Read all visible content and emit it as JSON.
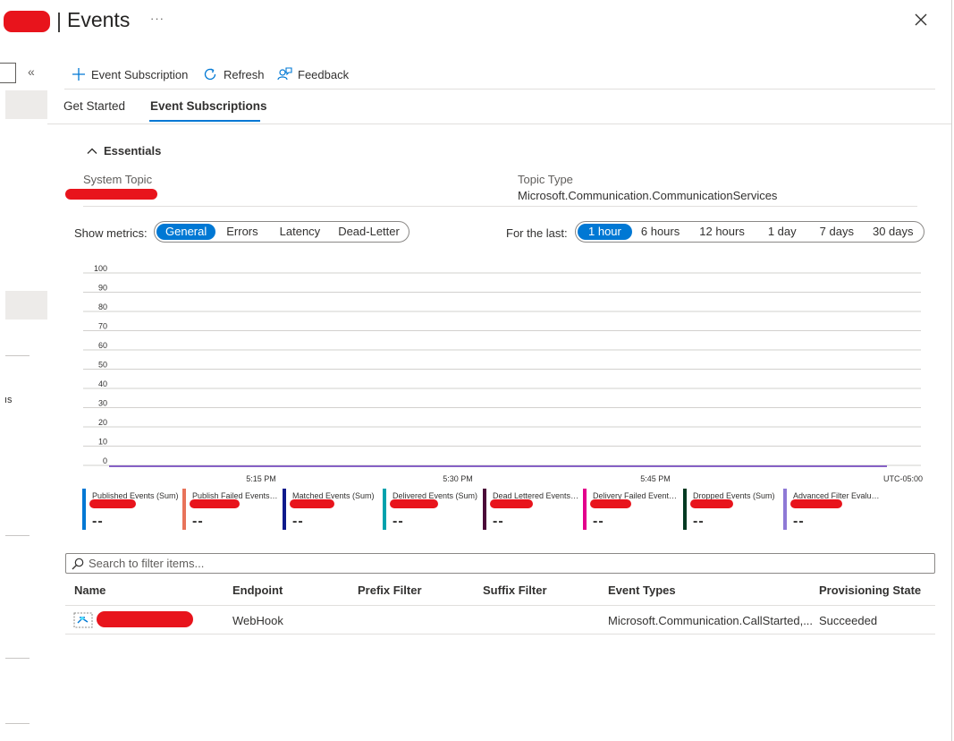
{
  "header": {
    "title": "Events",
    "separator": "|",
    "more": "···"
  },
  "left_rail": {
    "partial_text": "ıs"
  },
  "toolbar": {
    "event_subscription_label": "Event Subscription",
    "refresh_label": "Refresh",
    "feedback_label": "Feedback"
  },
  "tabs": [
    {
      "label": "Get Started",
      "active": false
    },
    {
      "label": "Event Subscriptions",
      "active": true
    }
  ],
  "essentials": {
    "toggle_label": "Essentials",
    "system_topic_label": "System Topic",
    "topic_type_label": "Topic Type",
    "topic_type_value": "Microsoft.Communication.CommunicationServices"
  },
  "metrics": {
    "show_label": "Show metrics:",
    "options": [
      "General",
      "Errors",
      "Latency",
      "Dead-Letter"
    ],
    "selected": "General",
    "time_label": "For the last:",
    "time_options": [
      "1 hour",
      "6 hours",
      "12 hours",
      "1 day",
      "7 days",
      "30 days"
    ],
    "time_selected": "1 hour"
  },
  "chart_data": {
    "type": "line",
    "title": "",
    "xlabel": "",
    "ylabel": "",
    "ylim": [
      0,
      100
    ],
    "y_ticks": [
      0,
      10,
      20,
      30,
      40,
      50,
      60,
      70,
      80,
      90,
      100
    ],
    "x_ticks": [
      "5:15 PM",
      "5:30 PM",
      "5:45 PM"
    ],
    "timezone_label": "UTC-05:00",
    "grid": true,
    "series": [
      {
        "values": [
          0,
          0
        ],
        "color": "#8661c5"
      }
    ]
  },
  "legend": [
    {
      "name": "Published Events (Sum)",
      "value": "--",
      "color": "#0078d4"
    },
    {
      "name": "Publish Failed Events (Sum)",
      "value": "--",
      "color": "#e8735a"
    },
    {
      "name": "Matched Events (Sum)",
      "value": "--",
      "color": "#0f1a8c"
    },
    {
      "name": "Delivered Events (Sum)",
      "value": "--",
      "color": "#00a2ad"
    },
    {
      "name": "Dead Lettered Events (Sum)",
      "value": "--",
      "color": "#4b0a38"
    },
    {
      "name": "Delivery Failed Events (Sum)",
      "value": "--",
      "color": "#e3008c"
    },
    {
      "name": "Dropped Events (Sum)",
      "value": "--",
      "color": "#013a22"
    },
    {
      "name": "Advanced Filter Evaluation Count Exceeded Events (Sum)",
      "value": "--",
      "color": "#8e79d6"
    }
  ],
  "filter": {
    "placeholder": "Search to filter items..."
  },
  "table": {
    "columns": [
      "Name",
      "Endpoint",
      "Prefix Filter",
      "Suffix Filter",
      "Event Types",
      "Provisioning State"
    ],
    "rows": [
      {
        "endpoint": "WebHook",
        "prefix_filter": "",
        "suffix_filter": "",
        "event_types": "Microsoft.Communication.CallStarted,...",
        "provisioning_state": "Succeeded"
      }
    ]
  }
}
